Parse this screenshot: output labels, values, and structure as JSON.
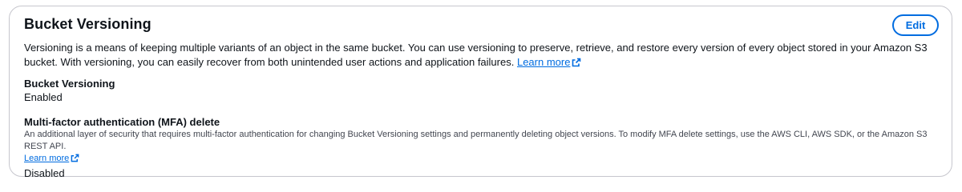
{
  "panel": {
    "title": "Bucket Versioning",
    "edit_label": "Edit",
    "description": "Versioning is a means of keeping multiple variants of an object in the same bucket. You can use versioning to preserve, retrieve, and restore every version of every object stored in your Amazon S3 bucket. With versioning, you can easily recover from both unintended user actions and application failures.",
    "learn_more": "Learn more"
  },
  "fields": {
    "versioning": {
      "label": "Bucket Versioning",
      "value": "Enabled"
    },
    "mfa": {
      "label": "Multi-factor authentication (MFA) delete",
      "description": "An additional layer of security that requires multi-factor authentication for changing Bucket Versioning settings and permanently deleting object versions. To modify MFA delete settings, use the AWS CLI, AWS SDK, or the Amazon S3 REST API.",
      "learn_more": "Learn more",
      "value": "Disabled"
    }
  },
  "icons": {
    "external": "external-link-icon"
  },
  "colors": {
    "link": "#006ce0",
    "border": "#c6c6cd",
    "text": "#0f141a",
    "secondary_text": "#424650"
  }
}
